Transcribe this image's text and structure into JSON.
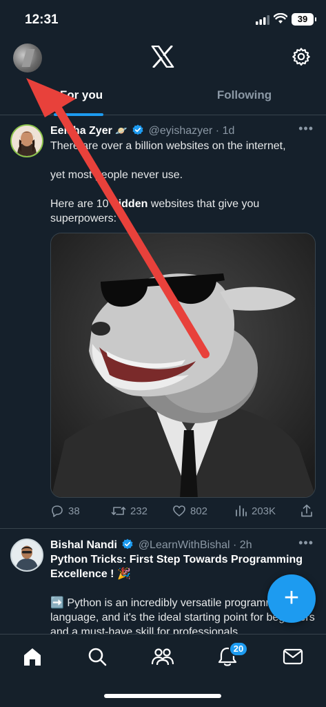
{
  "status_bar": {
    "time": "12:31",
    "battery": "39"
  },
  "header": {
    "logo": "x-logo",
    "settings_icon": "gear-icon"
  },
  "tabs": [
    {
      "label": "For you",
      "active": true
    },
    {
      "label": "Following",
      "active": false
    }
  ],
  "tweets": [
    {
      "name": "Eeisha Zyer",
      "name_emoji": "🪐",
      "handle": "@eyishazyer",
      "time": "· 1d",
      "text": [
        "There are over a billion websites on the internet,",
        "yet most people never use.",
        "Here are 10 hidden websites that give you superpowers:"
      ],
      "bold_word": "hidden",
      "stats": {
        "replies": "38",
        "retweets": "232",
        "likes": "802",
        "views": "203K"
      }
    },
    {
      "name": "Bishal Nandi",
      "handle": "@LearnWithBishal",
      "time": "· 2h",
      "title": "Python Tricks: First Step Towards Programming Excellence ! 🎉",
      "text": "➡️ Python is an incredibly versatile programming language, and it's the ideal starting point for beginners and a must-have skill for professionals"
    }
  ],
  "fab_label": "+",
  "bottom_nav": {
    "items": [
      "home-icon",
      "search-icon",
      "communities-icon",
      "notifications-icon",
      "messages-icon"
    ],
    "notification_count": "20"
  },
  "colors": {
    "background": "#15202b",
    "accent": "#1d9bf0",
    "annotation_arrow": "#e8413b"
  }
}
